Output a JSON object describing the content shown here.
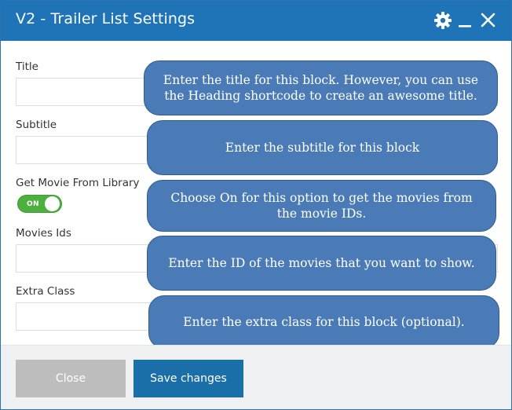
{
  "window": {
    "title": "V2 - Trailer List Settings"
  },
  "titlebar_icons": [
    "gear-icon",
    "minimize-icon",
    "close-icon"
  ],
  "fields": [
    {
      "label": "Title",
      "value": ""
    },
    {
      "label": "Subtitle",
      "value": ""
    },
    {
      "label": "Movies Ids",
      "value": ""
    },
    {
      "label": "Extra Class",
      "value": ""
    }
  ],
  "toggle": {
    "label": "Get Movie From Library",
    "state_text": "ON",
    "on": true
  },
  "tooltips": [
    "Enter the title for this block. However, you can use the Heading shortcode to create an awesome title.",
    "Enter the subtitle for this block",
    "Choose On for this option to get the movies from the movie IDs.",
    "Enter the ID of the movies that you want to show.",
    "Enter the extra class for this block (optional)."
  ],
  "buttons": {
    "close": "Close",
    "save": "Save changes"
  },
  "colors": {
    "titlebar": "#1f73b7",
    "tooltip": "#4a7bb6",
    "toggle_on": "#4caf3e",
    "save_button": "#1a6fa8",
    "close_button": "#bdbdbd"
  }
}
